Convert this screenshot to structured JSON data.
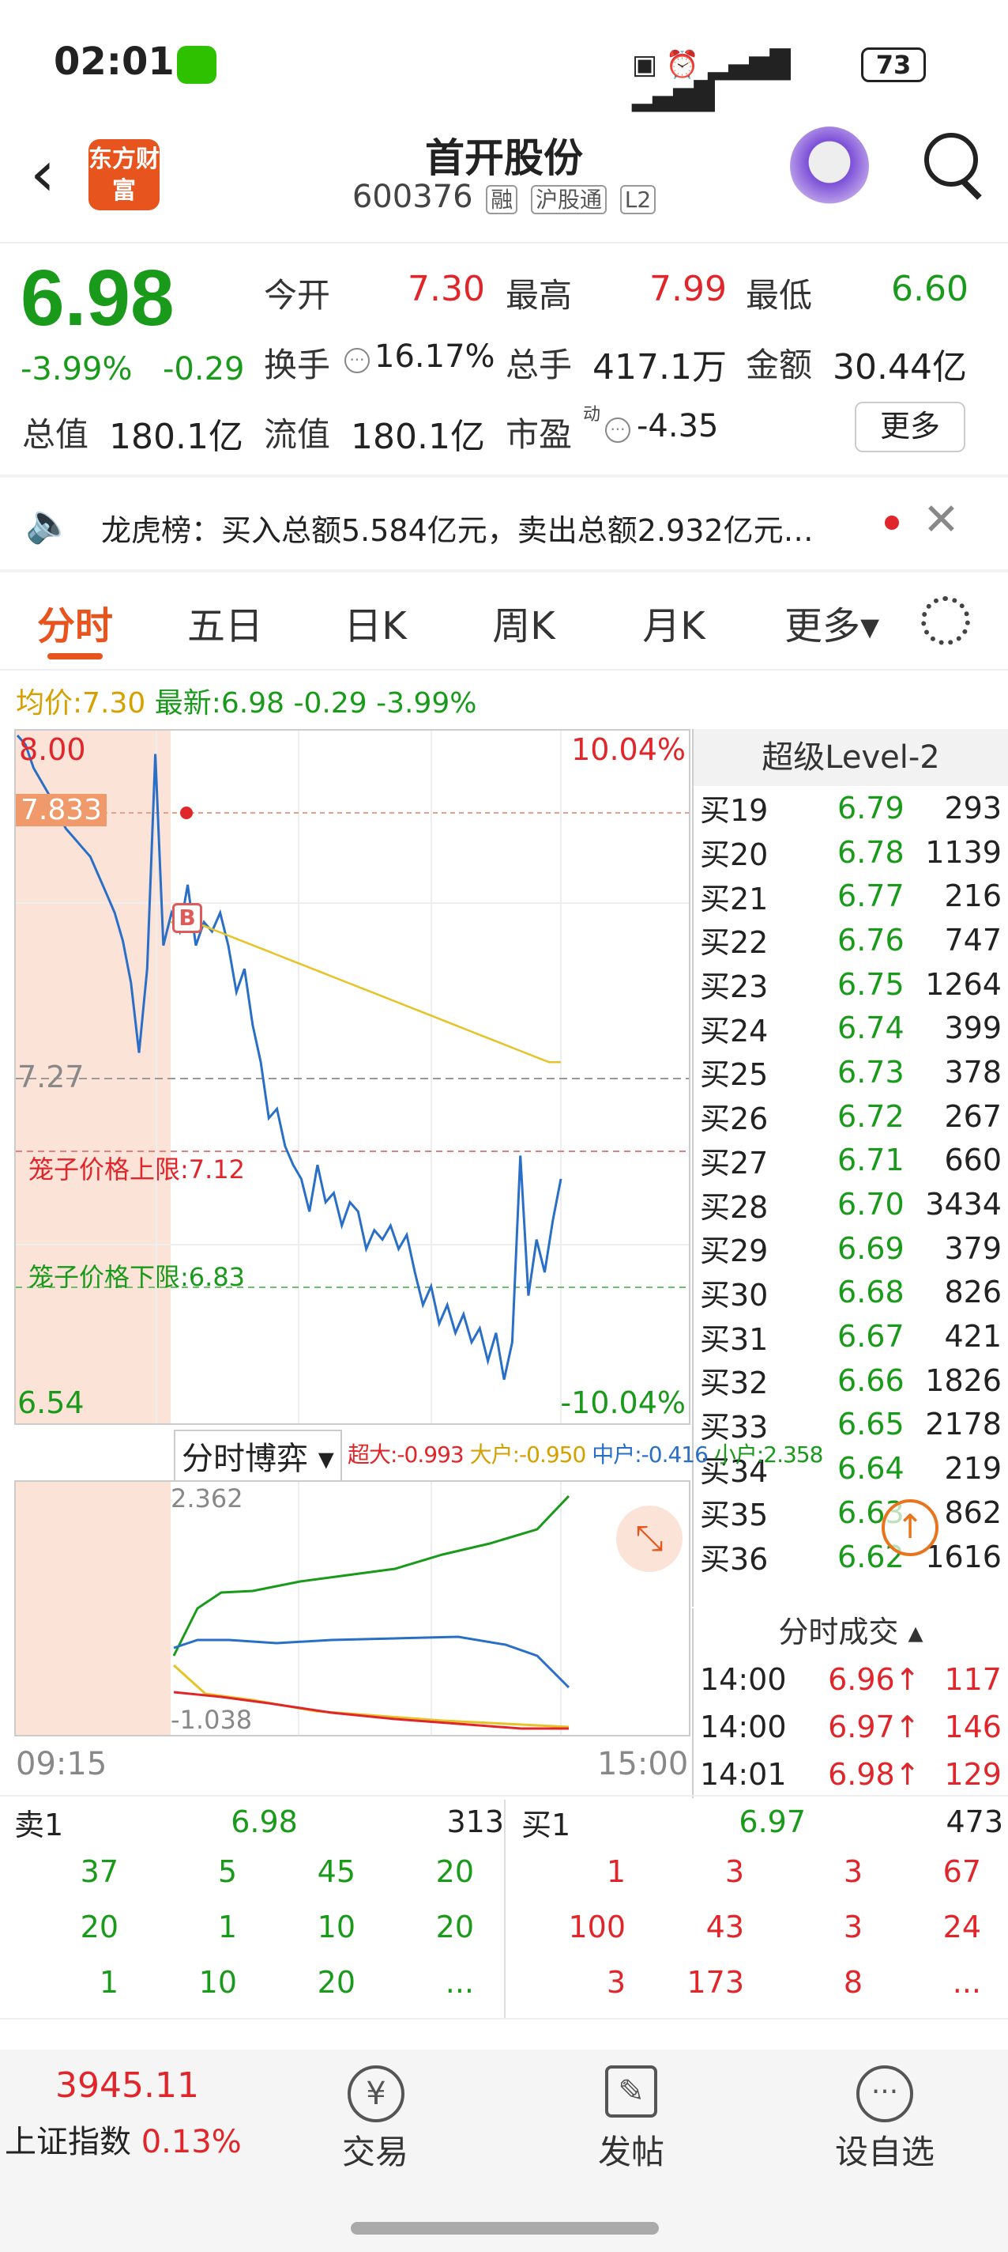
{
  "status_bar": {
    "time": "02:01",
    "battery": "73"
  },
  "header": {
    "title": "首开股份",
    "code": "600376",
    "tags": [
      "融",
      "沪股通",
      "L2"
    ],
    "logo_text": "东方财富"
  },
  "quote": {
    "price": "6.98",
    "pct": "-3.99%",
    "change": "-0.29",
    "open_label": "今开",
    "open": "7.30",
    "high_label": "最高",
    "high": "7.99",
    "low_label": "最低",
    "low": "6.60",
    "turnover_label": "换手",
    "turnover": "16.17%",
    "volume_label": "总手",
    "volume": "417.1万",
    "amount_label": "金额",
    "amount": "30.44亿",
    "mcap_label": "总值",
    "mcap": "180.1亿",
    "float_label": "流值",
    "float": "180.1亿",
    "pe_label": "市盈",
    "pe_sup": "动",
    "pe": "-4.35",
    "more": "更多"
  },
  "notice": {
    "text": "龙虎榜：买入总额5.584亿元，卖出总额2.932亿元…"
  },
  "tabs": [
    "分时",
    "五日",
    "日K",
    "周K",
    "月K",
    "更多▾"
  ],
  "chart_info": {
    "avg_label": "均价:",
    "avg": "7.30",
    "latest_label": "最新:",
    "latest": "6.98",
    "chg": "-0.29",
    "pct": "-3.99%"
  },
  "chart_labels": {
    "top": "8.00",
    "top_pct": "10.04%",
    "marker": "7.833",
    "mid": "7.27",
    "upper_cage": "笼子价格上限:7.12",
    "lower_cage": "笼子价格下限:6.83",
    "bottom": "6.54",
    "bottom_pct": "-10.04%",
    "b_marker": "B"
  },
  "chart_data": {
    "type": "line",
    "ylim": [
      6.54,
      8.0
    ],
    "series": [
      {
        "values": [
          8.0,
          7.98,
          7.93,
          7.9,
          7.87,
          7.83,
          7.8,
          7.78,
          7.76,
          7.74,
          7.7,
          7.66,
          7.62,
          7.56,
          7.47,
          7.32,
          7.5,
          7.96,
          7.55,
          7.62,
          7.58,
          7.68,
          7.55,
          7.6,
          7.58,
          7.62,
          7.55,
          7.45,
          7.5,
          7.38,
          7.3,
          7.18,
          7.2,
          7.12,
          7.08,
          7.05,
          6.98,
          7.08,
          7.0,
          7.02,
          6.95,
          7.0,
          6.98,
          6.9,
          6.94,
          6.92,
          6.95,
          6.9,
          6.93,
          6.85,
          6.78,
          6.82,
          6.74,
          6.78,
          6.72,
          6.76,
          6.7,
          6.73,
          6.66,
          6.72,
          6.62,
          6.7,
          7.1,
          6.8,
          6.92,
          6.85,
          6.96,
          7.05
        ]
      },
      {
        "values": [
          7.6,
          7.6,
          7.6,
          7.59,
          7.58,
          7.57,
          7.56,
          7.55,
          7.54,
          7.53,
          7.52,
          7.51,
          7.5,
          7.49,
          7.48,
          7.47,
          7.46,
          7.45,
          7.44,
          7.43,
          7.42,
          7.41,
          7.4,
          7.39,
          7.38,
          7.37,
          7.36,
          7.35,
          7.34,
          7.33,
          7.32,
          7.31,
          7.3,
          7.3
        ]
      }
    ]
  },
  "level2": {
    "title": "超级Level-2",
    "rows": [
      [
        "买19",
        "6.79",
        "293"
      ],
      [
        "买20",
        "6.78",
        "1139"
      ],
      [
        "买21",
        "6.77",
        "216"
      ],
      [
        "买22",
        "6.76",
        "747"
      ],
      [
        "买23",
        "6.75",
        "1264"
      ],
      [
        "买24",
        "6.74",
        "399"
      ],
      [
        "买25",
        "6.73",
        "378"
      ],
      [
        "买26",
        "6.72",
        "267"
      ],
      [
        "买27",
        "6.71",
        "660"
      ],
      [
        "买28",
        "6.70",
        "3434"
      ],
      [
        "买29",
        "6.69",
        "379"
      ],
      [
        "买30",
        "6.68",
        "826"
      ],
      [
        "买31",
        "6.67",
        "421"
      ],
      [
        "买32",
        "6.66",
        "1826"
      ],
      [
        "买33",
        "6.65",
        "2178"
      ],
      [
        "买34",
        "6.64",
        "219"
      ],
      [
        "买35",
        "6.63",
        "862"
      ],
      [
        "买36",
        "6.62",
        "1616"
      ]
    ]
  },
  "sub_chart": {
    "title": "分时博弈 ▾",
    "legend": [
      "超大:-0.993",
      "大户:-0.950",
      "中户:-0.416",
      "小户:2.358"
    ],
    "top": "2.362",
    "bottom": "-1.038",
    "time_start": "09:15",
    "time_end": "15:00"
  },
  "ticks": {
    "title": "分时成交 ▴",
    "rows": [
      [
        "14:00",
        "6.96",
        "117"
      ],
      [
        "14:00",
        "6.97",
        "146"
      ],
      [
        "14:01",
        "6.98",
        "129"
      ]
    ]
  },
  "order_book": {
    "sell": {
      "label": "卖1",
      "price": "6.98",
      "vol": "313",
      "rows": [
        [
          "37",
          "5",
          "45",
          "20"
        ],
        [
          "20",
          "1",
          "10",
          "20"
        ],
        [
          "1",
          "10",
          "20",
          "..."
        ]
      ]
    },
    "buy": {
      "label": "买1",
      "price": "6.97",
      "vol": "473",
      "rows": [
        [
          "1",
          "3",
          "3",
          "67"
        ],
        [
          "100",
          "43",
          "3",
          "24"
        ],
        [
          "3",
          "173",
          "8",
          "..."
        ]
      ]
    }
  },
  "bottom_nav": {
    "index_value": "3945.11",
    "index_name": "上证指数",
    "index_pct": "0.13%",
    "items": [
      "交易",
      "发帖",
      "设自选"
    ]
  }
}
